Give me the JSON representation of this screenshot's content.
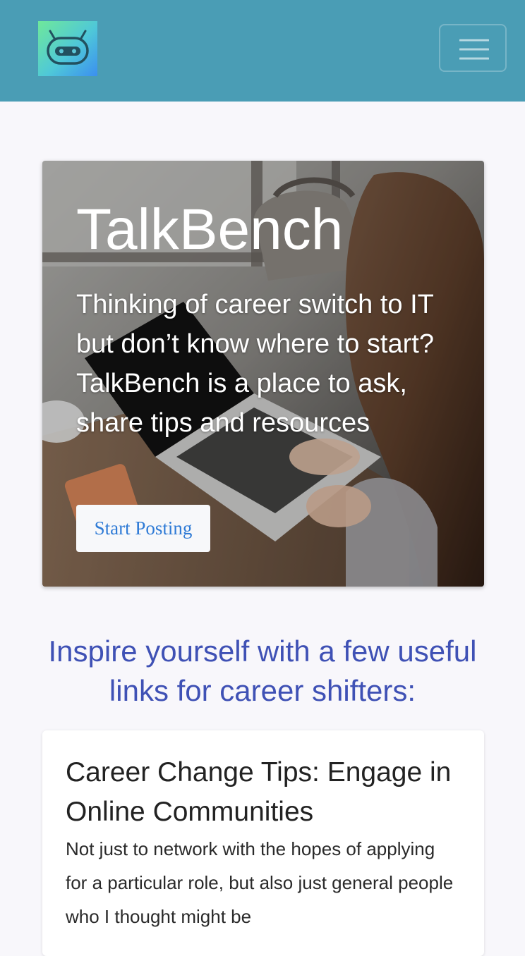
{
  "navbar": {
    "logo_alt": "robot logo",
    "toggle_icon": "hamburger-menu-icon",
    "background_color": "#4a9db5"
  },
  "hero": {
    "title": "TalkBench",
    "description": "Thinking of career switch to IT but don’t know where to start? TalkBench is a place to ask, share tips and resources",
    "button_label": "Start Posting",
    "background_image": "woman typing on laptop at desk"
  },
  "links_section": {
    "heading": "Inspire yourself with a few useful links for career shifters:",
    "heading_color": "#3f51b5"
  },
  "cards": [
    {
      "title": "Career Change Tips: Engage in Online Communities",
      "text": "Not just to network with the hopes of applying for a particular role, but also just general people who I thought might be"
    }
  ]
}
